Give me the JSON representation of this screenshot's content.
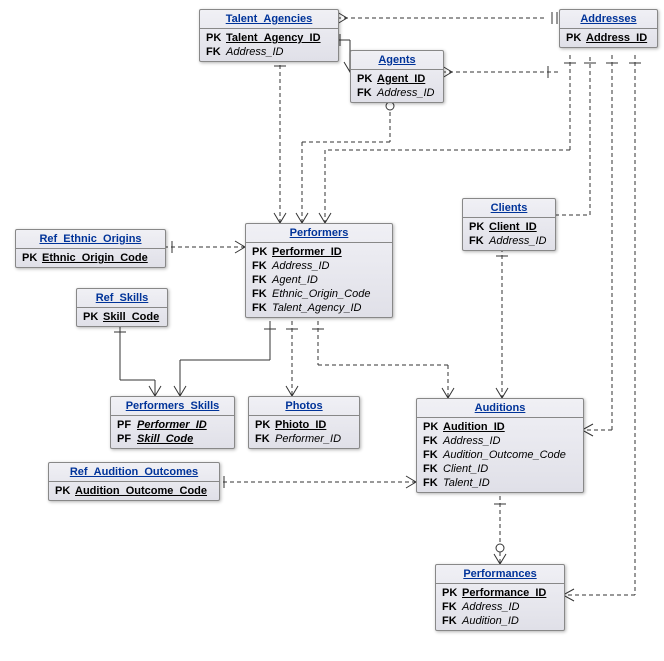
{
  "entities": {
    "talent_agencies": {
      "title": "Talent_Agencies",
      "attrs": [
        {
          "key": "PK",
          "name": "Talent_Agency_ID",
          "cls": "pk"
        },
        {
          "key": "FK",
          "name": "Address_ID",
          "cls": "fk"
        }
      ]
    },
    "agents": {
      "title": "Agents",
      "attrs": [
        {
          "key": "PK",
          "name": "Agent_ID",
          "cls": "pk"
        },
        {
          "key": "FK",
          "name": "Address_ID",
          "cls": "fk"
        }
      ]
    },
    "addresses": {
      "title": "Addresses",
      "attrs": [
        {
          "key": "PK",
          "name": "Address_ID",
          "cls": "pk"
        }
      ]
    },
    "ref_ethnic_origins": {
      "title": "Ref_Ethnic_Origins",
      "attrs": [
        {
          "key": "PK",
          "name": "Ethnic_Origin_Code",
          "cls": "pk"
        }
      ]
    },
    "ref_skills": {
      "title": "Ref_Skills",
      "attrs": [
        {
          "key": "PK",
          "name": "Skill_Code",
          "cls": "pk"
        }
      ]
    },
    "performers": {
      "title": "Performers",
      "attrs": [
        {
          "key": "PK",
          "name": "Performer_ID",
          "cls": "pk"
        },
        {
          "key": "FK",
          "name": "Address_ID",
          "cls": "fk"
        },
        {
          "key": "FK",
          "name": "Agent_ID",
          "cls": "fk"
        },
        {
          "key": "FK",
          "name": "Ethnic_Origin_Code",
          "cls": "fk"
        },
        {
          "key": "FK",
          "name": "Talent_Agency_ID",
          "cls": "fk"
        }
      ]
    },
    "clients": {
      "title": "Clients",
      "attrs": [
        {
          "key": "PK",
          "name": "Client_ID",
          "cls": "pk"
        },
        {
          "key": "FK",
          "name": "Address_ID",
          "cls": "fk"
        }
      ]
    },
    "performers_skills": {
      "title": "Performers_Skills",
      "attrs": [
        {
          "key": "PF",
          "name": "Performer_ID",
          "cls": "pf"
        },
        {
          "key": "PF",
          "name": "Skill_Code",
          "cls": "pf"
        }
      ]
    },
    "photos": {
      "title": "Photos",
      "attrs": [
        {
          "key": "PK",
          "name": "Phioto_ID",
          "cls": "pk"
        },
        {
          "key": "FK",
          "name": "Performer_ID",
          "cls": "fk"
        }
      ]
    },
    "ref_audition_outcomes": {
      "title": "Ref_Audition_Outcomes",
      "attrs": [
        {
          "key": "PK",
          "name": "Audition_Outcome_Code",
          "cls": "pk"
        }
      ]
    },
    "auditions": {
      "title": "Auditions",
      "attrs": [
        {
          "key": "PK",
          "name": "Audition_ID",
          "cls": "pk"
        },
        {
          "key": "FK",
          "name": "Address_ID",
          "cls": "fk"
        },
        {
          "key": "FK",
          "name": "Audition_Outcome_Code",
          "cls": "fk"
        },
        {
          "key": "FK",
          "name": "Client_ID",
          "cls": "fk"
        },
        {
          "key": "FK",
          "name": "Talent_ID",
          "cls": "fk"
        }
      ]
    },
    "performances": {
      "title": "Performances",
      "attrs": [
        {
          "key": "PK",
          "name": "Performance_ID",
          "cls": "pk"
        },
        {
          "key": "FK",
          "name": "Address_ID",
          "cls": "fk"
        },
        {
          "key": "FK",
          "name": "Audition_ID",
          "cls": "fk"
        }
      ]
    }
  }
}
